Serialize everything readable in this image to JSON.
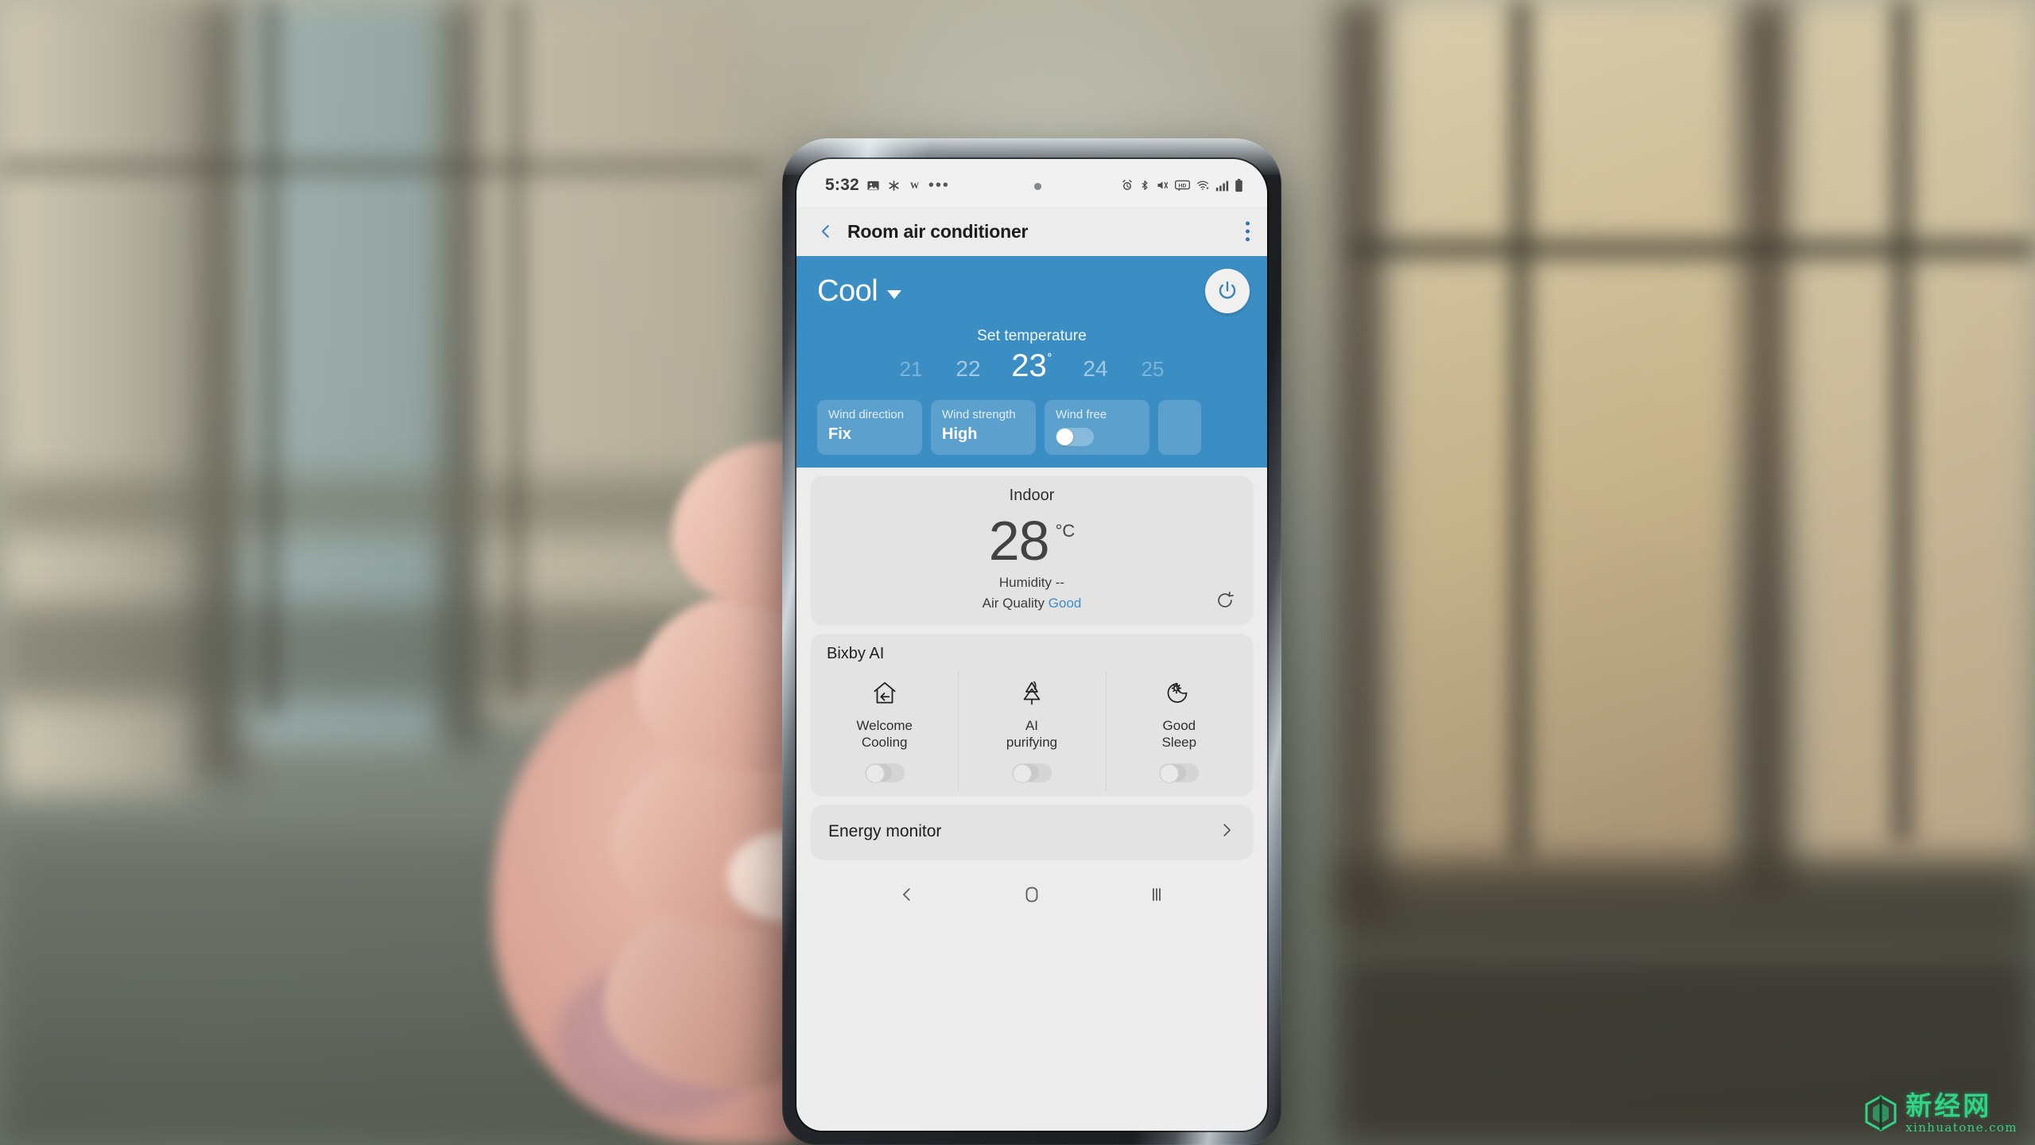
{
  "status_bar": {
    "time": "5:32",
    "left_icons": [
      "image-icon",
      "smartthings-icon",
      "w-app-icon",
      "more-notifications-icon"
    ],
    "right_icons": [
      "alarm-icon",
      "bluetooth-icon",
      "mute-vibrate-icon",
      "hd-icon",
      "wifi-icon",
      "signal-icon",
      "battery-icon"
    ]
  },
  "app_bar": {
    "back_icon": "chevron-left-icon",
    "title": "Room air conditioner",
    "menu_icon": "overflow-menu-icon"
  },
  "control_panel": {
    "accent_color": "#3b8ec4",
    "mode": "Cool",
    "mode_caret_icon": "caret-down-icon",
    "power_icon": "power-icon",
    "set_temperature_label": "Set temperature",
    "temperatures": [
      {
        "value": "21",
        "selected": false,
        "far": true
      },
      {
        "value": "22",
        "selected": false,
        "far": false
      },
      {
        "value": "23",
        "selected": true,
        "far": false,
        "degree": "˚"
      },
      {
        "value": "24",
        "selected": false,
        "far": false
      },
      {
        "value": "25",
        "selected": false,
        "far": true
      }
    ],
    "chips": [
      {
        "label": "Wind direction",
        "value": "Fix",
        "type": "value"
      },
      {
        "label": "Wind strength",
        "value": "High",
        "type": "value"
      },
      {
        "label": "Wind free",
        "value": "",
        "type": "toggle",
        "toggle_on": false
      }
    ]
  },
  "indoor_card": {
    "title": "Indoor",
    "temperature": "28",
    "unit": "°C",
    "humidity_label": "Humidity",
    "humidity_value": "--",
    "air_quality_label": "Air Quality",
    "air_quality_value": "Good",
    "air_quality_color": "#3f8dcb",
    "refresh_icon": "refresh-icon"
  },
  "bixby_card": {
    "title": "Bixby AI",
    "items": [
      {
        "icon": "house-arrow-icon",
        "line1": "Welcome",
        "line2": "Cooling",
        "toggle_on": false
      },
      {
        "icon": "tree-purify-icon",
        "line1": "AI",
        "line2": "purifying",
        "toggle_on": false
      },
      {
        "icon": "moon-sleep-icon",
        "line1": "Good",
        "line2": "Sleep",
        "toggle_on": false
      }
    ]
  },
  "energy_row": {
    "label": "Energy monitor",
    "chevron_icon": "chevron-right-icon"
  },
  "nav_bar": {
    "back_icon": "nav-back-icon",
    "home_icon": "nav-home-icon",
    "recents_icon": "nav-recents-icon"
  },
  "watermark": {
    "cn": "新经网",
    "en": "xinhuatone.com",
    "color": "#2ee08a"
  }
}
